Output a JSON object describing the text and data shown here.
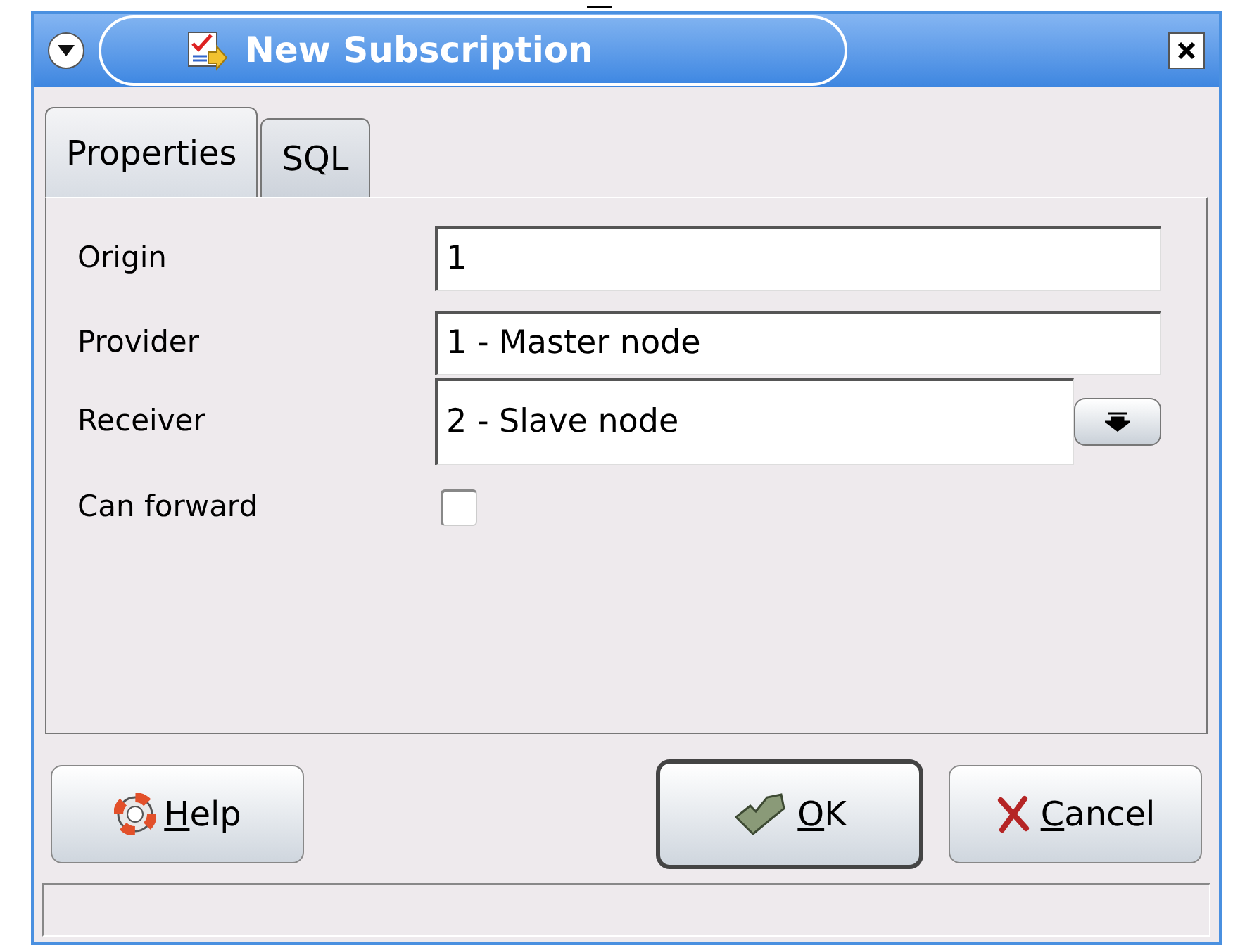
{
  "window": {
    "title": "New Subscription"
  },
  "tabs": [
    {
      "label": "Properties",
      "selected": true
    },
    {
      "label": "SQL",
      "selected": false
    }
  ],
  "fields": [
    {
      "kind": "text",
      "label": "Origin",
      "value": "1"
    },
    {
      "kind": "text",
      "label": "Provider",
      "value": "1 - Master node"
    },
    {
      "kind": "picker",
      "label": "Receiver",
      "value": "2 - Slave node"
    },
    {
      "kind": "checkbox",
      "label": "Can forward",
      "checked": false
    }
  ],
  "buttons": [
    {
      "kind": "help",
      "label": "Help",
      "underline_first": true,
      "default": false
    },
    {
      "kind": "ok",
      "label": "OK",
      "underline_first": true,
      "default": true
    },
    {
      "kind": "cancel",
      "label": "Cancel",
      "underline_first": true,
      "default": false
    }
  ]
}
